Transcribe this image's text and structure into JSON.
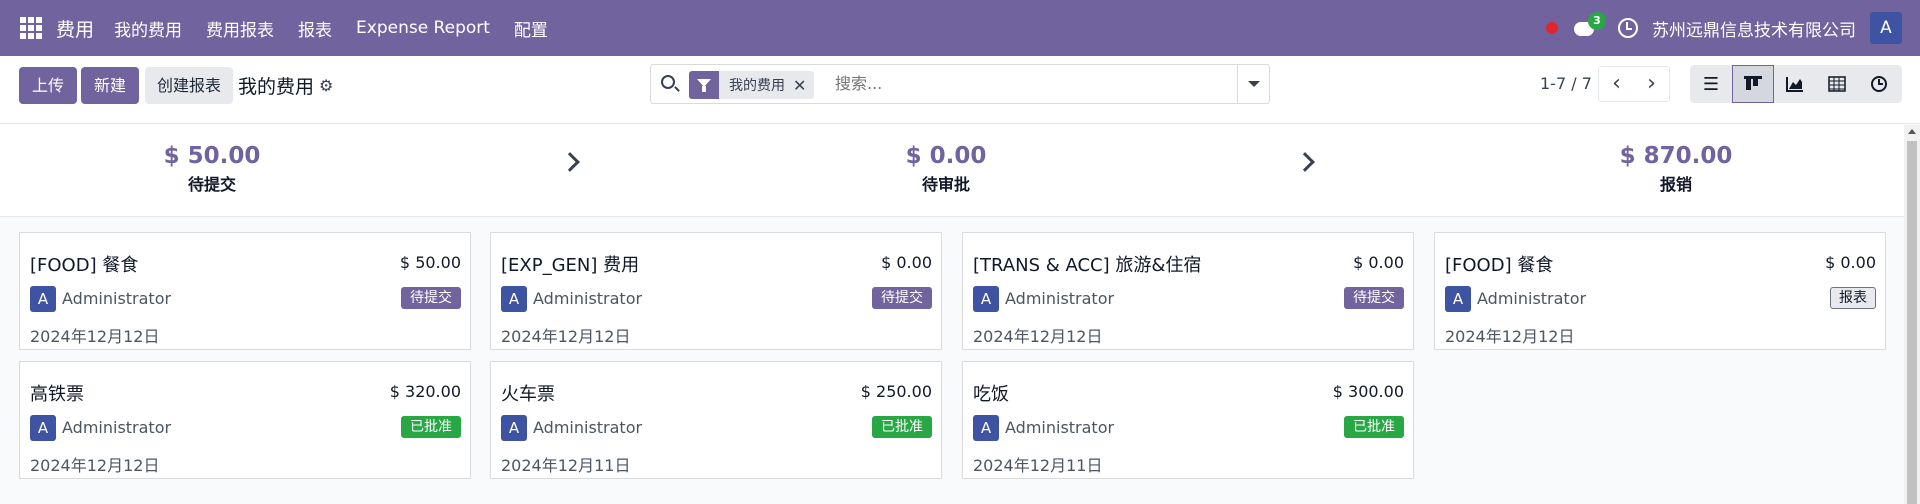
{
  "navbar": {
    "app_name": "费用",
    "menu": [
      "我的费用",
      "费用报表",
      "报表",
      "Expense Report",
      "配置"
    ],
    "chat_count": "3",
    "company": "苏州远鼎信息技术有限公司",
    "user_initial": "A"
  },
  "control_panel": {
    "upload_label": "上传",
    "new_label": "新建",
    "create_report_label": "创建报表",
    "breadcrumb": "我的费用",
    "search": {
      "facet": "我的费用",
      "placeholder": "搜索..."
    },
    "pager": "1-7 / 7"
  },
  "stages": [
    {
      "amount": "$ 50.00",
      "label": "待提交"
    },
    {
      "amount": "$ 0.00",
      "label": "待审批"
    },
    {
      "amount": "$ 870.00",
      "label": "报销"
    }
  ],
  "cards": [
    {
      "title": "[FOOD] 餐食",
      "amount": "$ 50.00",
      "avatar": "A",
      "owner": "Administrator",
      "status": "待提交",
      "status_type": "draft",
      "date": "2024年12月12日"
    },
    {
      "title": "[EXP_GEN] 费用",
      "amount": "$ 0.00",
      "avatar": "A",
      "owner": "Administrator",
      "status": "待提交",
      "status_type": "draft",
      "date": "2024年12月12日"
    },
    {
      "title": "[TRANS & ACC] 旅游&住宿",
      "amount": "$ 0.00",
      "avatar": "A",
      "owner": "Administrator",
      "status": "待提交",
      "status_type": "draft",
      "date": "2024年12月12日"
    },
    {
      "title": "[FOOD] 餐食",
      "amount": "$ 0.00",
      "avatar": "A",
      "owner": "Administrator",
      "status": "报表",
      "status_type": "report",
      "date": "2024年12月12日"
    },
    {
      "title": "高铁票",
      "amount": "$ 320.00",
      "avatar": "A",
      "owner": "Administrator",
      "status": "已批准",
      "status_type": "approved",
      "date": "2024年12月12日"
    },
    {
      "title": "火车票",
      "amount": "$ 250.00",
      "avatar": "A",
      "owner": "Administrator",
      "status": "已批准",
      "status_type": "approved",
      "date": "2024年12月11日"
    },
    {
      "title": "吃饭",
      "amount": "$ 300.00",
      "avatar": "A",
      "owner": "Administrator",
      "status": "已批准",
      "status_type": "approved",
      "date": "2024年12月11日"
    }
  ],
  "colors": {
    "brand": "#71639e",
    "approved": "#28a745",
    "avatar": "#3e53a2"
  }
}
